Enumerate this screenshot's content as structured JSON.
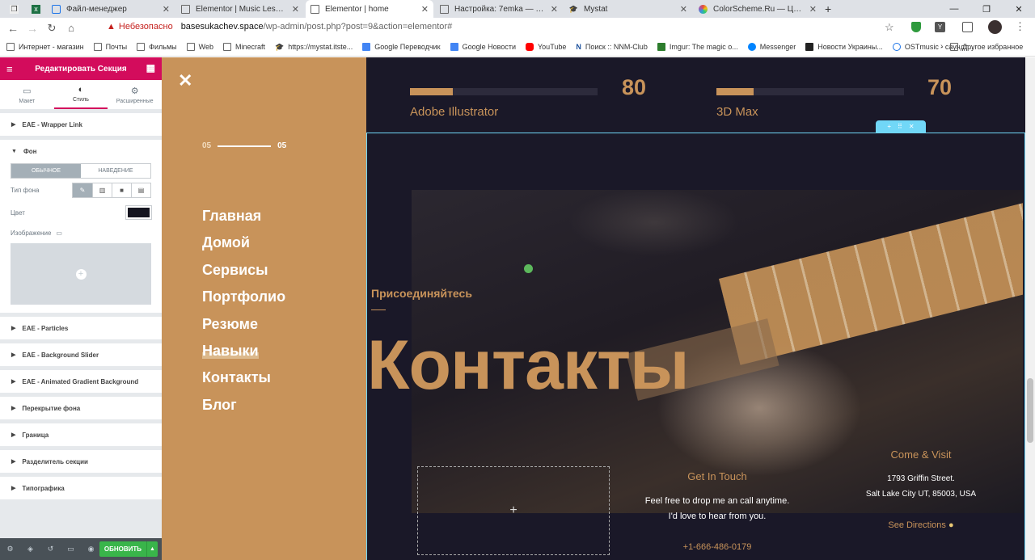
{
  "browser": {
    "tabs": [
      {
        "title": "",
        "icon": "excel-icon"
      },
      {
        "title": "Файл-менеджер",
        "icon": "file-manager-icon"
      },
      {
        "title": "Elementor | Music Lessons Teach",
        "icon": "page-icon"
      },
      {
        "title": "Elementor | home",
        "icon": "page-icon",
        "active": true
      },
      {
        "title": "Настройка: 7emka — Сайт порт",
        "icon": "page-icon"
      },
      {
        "title": "Mystat",
        "icon": "mystat-icon"
      },
      {
        "title": "ColorScheme.Ru — Цветовой к",
        "icon": "colorscheme-icon"
      }
    ],
    "security_label": "Небезопасно",
    "url_domain": "basesukachev.space",
    "url_path": "/wp-admin/post.php?post=9&action=elementor#",
    "bookmarks": [
      "Интернет - магазин",
      "Почты",
      "Фильмы",
      "Web",
      "Minecraft",
      "https://mystat.itste...",
      "Google Переводчик",
      "Google Новости",
      "YouTube",
      "Поиск :: NNM-Club",
      "Imgur: The magic o...",
      "Messenger",
      "Новости Украины...",
      "OSTmusic - саундт..."
    ],
    "other_bookmarks": "Другое избранное"
  },
  "panel": {
    "title": "Редактировать Секция",
    "tabs": [
      "Макет",
      "Стиль",
      "Расширенные"
    ],
    "active_tab": 1,
    "sections_top": [
      "EAE - Wrapper Link"
    ],
    "fon": {
      "title": "Фон",
      "toggle": [
        "ОБЫЧНОЕ",
        "НАВЕДЕНИЕ"
      ],
      "bg_type_label": "Тип фона",
      "color_label": "Цвет",
      "color_value": "#151520",
      "image_label": "Изображение"
    },
    "sections_bottom": [
      "EAE - Particles",
      "EAE - Background Slider",
      "EAE - Animated Gradient Background",
      "Перекрытие фона",
      "Граница",
      "Разделитель секции",
      "Типографика"
    ],
    "update_label": "ОБНОВИТЬ"
  },
  "site": {
    "counter_current": "05",
    "counter_total": "05",
    "nav": [
      "Главная",
      "Домой",
      "Сервисы",
      "Портфолио",
      "Резюме",
      "Навыки",
      "Контакты",
      "Блог"
    ],
    "skills": [
      {
        "name": "Adobe Illustrator",
        "value": "80",
        "level": 0.23
      },
      {
        "name": "3D Max",
        "value": "70",
        "level": 0.2
      }
    ],
    "join": "Присоединяйтесь",
    "contacts_title": "Контакты",
    "get_in_touch": "Get In Touch",
    "touch_line1": "Feel free to drop me an call anytime.",
    "touch_line2": "I'd love to hear from you.",
    "phone": "+1-666-486-0179",
    "come_visit": "Come & Visit",
    "address1": "1793 Griffin Street.",
    "address2": "Salt Lake City UT, 85003, USA",
    "directions": "See Directions"
  }
}
